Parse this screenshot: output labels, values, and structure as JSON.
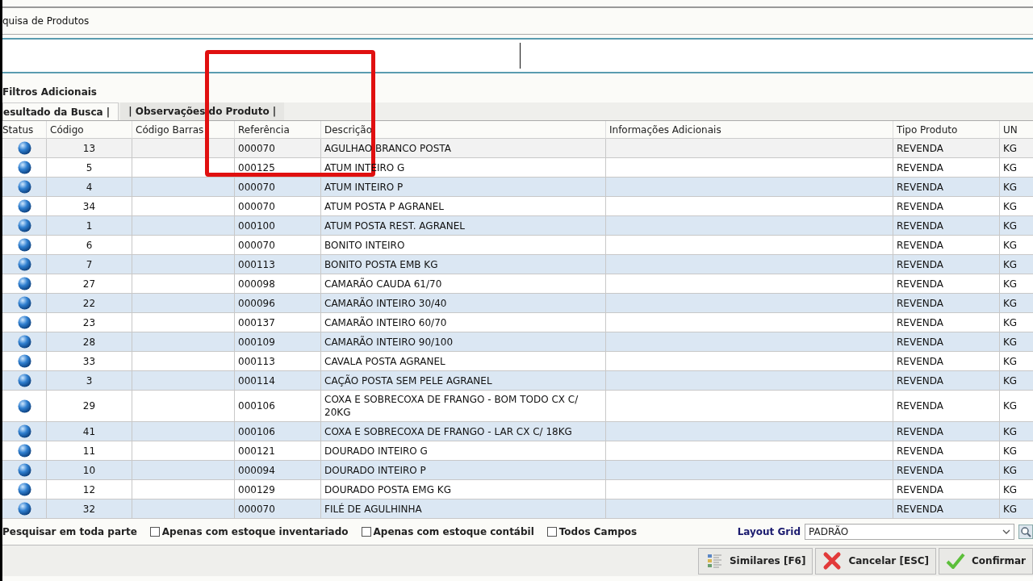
{
  "window": {
    "title": "quisa de Produtos"
  },
  "filters": {
    "label": "Filtros Adicionais"
  },
  "tabs": [
    {
      "label": "esultado da Busca |",
      "selected": true
    },
    {
      "label": "| Observações do Produto |",
      "selected": false
    }
  ],
  "table": {
    "columns": [
      "Status",
      "Código",
      "Código Barras",
      "Referência",
      "Descrição",
      "Informações Adicionais",
      "Tipo Produto",
      "UN"
    ],
    "rows": [
      {
        "codigo": "13",
        "barras": "",
        "referencia": "000070",
        "descricao": "AGULHAO BRANCO POSTA",
        "info": "",
        "tipo": "REVENDA",
        "un": "KG"
      },
      {
        "codigo": "5",
        "barras": "",
        "referencia": "000125",
        "descricao": "ATUM INTEIRO G",
        "info": "",
        "tipo": "REVENDA",
        "un": "KG"
      },
      {
        "codigo": "4",
        "barras": "",
        "referencia": "000070",
        "descricao": "ATUM INTEIRO P",
        "info": "",
        "tipo": "REVENDA",
        "un": "KG"
      },
      {
        "codigo": "34",
        "barras": "",
        "referencia": "000070",
        "descricao": "ATUM POSTA P AGRANEL",
        "info": "",
        "tipo": "REVENDA",
        "un": "KG"
      },
      {
        "codigo": "1",
        "barras": "",
        "referencia": "000100",
        "descricao": "ATUM POSTA REST. AGRANEL",
        "info": "",
        "tipo": "REVENDA",
        "un": "KG"
      },
      {
        "codigo": "6",
        "barras": "",
        "referencia": "000070",
        "descricao": "BONITO INTEIRO",
        "info": "",
        "tipo": "REVENDA",
        "un": "KG"
      },
      {
        "codigo": "7",
        "barras": "",
        "referencia": "000113",
        "descricao": "BONITO POSTA EMB KG",
        "info": "",
        "tipo": "REVENDA",
        "un": "KG"
      },
      {
        "codigo": "27",
        "barras": "",
        "referencia": "000098",
        "descricao": "CAMARÃO CAUDA 61/70",
        "info": "",
        "tipo": "REVENDA",
        "un": "KG"
      },
      {
        "codigo": "22",
        "barras": "",
        "referencia": "000096",
        "descricao": "CAMARÃO INTEIRO 30/40",
        "info": "",
        "tipo": "REVENDA",
        "un": "KG"
      },
      {
        "codigo": "23",
        "barras": "",
        "referencia": "000137",
        "descricao": "CAMARÃO INTEIRO 60/70",
        "info": "",
        "tipo": "REVENDA",
        "un": "KG"
      },
      {
        "codigo": "28",
        "barras": "",
        "referencia": "000109",
        "descricao": "CAMARÃO INTEIRO 90/100",
        "info": "",
        "tipo": "REVENDA",
        "un": "KG"
      },
      {
        "codigo": "33",
        "barras": "",
        "referencia": "000113",
        "descricao": "CAVALA POSTA AGRANEL",
        "info": "",
        "tipo": "REVENDA",
        "un": "KG"
      },
      {
        "codigo": "3",
        "barras": "",
        "referencia": "000114",
        "descricao": "CAÇÃO POSTA SEM PELE AGRANEL",
        "info": "",
        "tipo": "REVENDA",
        "un": "KG"
      },
      {
        "codigo": "29",
        "barras": "",
        "referencia": "000106",
        "descricao": "COXA E SOBRECOXA DE FRANGO - BOM TODO CX C/ 20KG",
        "info": "",
        "tipo": "REVENDA",
        "un": "KG"
      },
      {
        "codigo": "41",
        "barras": "",
        "referencia": "000106",
        "descricao": "COXA E SOBRECOXA DE FRANGO - LAR CX C/ 18KG",
        "info": "",
        "tipo": "REVENDA",
        "un": "KG"
      },
      {
        "codigo": "11",
        "barras": "",
        "referencia": "000121",
        "descricao": "DOURADO INTEIRO G",
        "info": "",
        "tipo": "REVENDA",
        "un": "KG"
      },
      {
        "codigo": "10",
        "barras": "",
        "referencia": "000094",
        "descricao": "DOURADO INTEIRO P",
        "info": "",
        "tipo": "REVENDA",
        "un": "KG"
      },
      {
        "codigo": "12",
        "barras": "",
        "referencia": "000129",
        "descricao": "DOURADO POSTA EMG KG",
        "info": "",
        "tipo": "REVENDA",
        "un": "KG"
      },
      {
        "codigo": "32",
        "barras": "",
        "referencia": "000070",
        "descricao": "FILÉ DE AGULHINHA",
        "info": "",
        "tipo": "REVENDA",
        "un": "KG"
      }
    ]
  },
  "options": [
    {
      "kind": "label",
      "label": "Pesquisar em toda parte"
    },
    {
      "kind": "checkbox",
      "label": "Apenas com estoque inventariado",
      "checked": false
    },
    {
      "kind": "checkbox",
      "label": "Apenas com estoque contábil",
      "checked": false
    },
    {
      "kind": "checkbox",
      "label": "Todos Campos",
      "checked": false
    }
  ],
  "layout_grid": {
    "label": "Layout Grid",
    "value": "PADRÃO"
  },
  "buttons": [
    {
      "kind": "similar",
      "label": "Similares [F6]"
    },
    {
      "kind": "cancel",
      "label": "Cancelar [ESC]"
    },
    {
      "kind": "confirm",
      "label": "Confirmar"
    }
  ]
}
